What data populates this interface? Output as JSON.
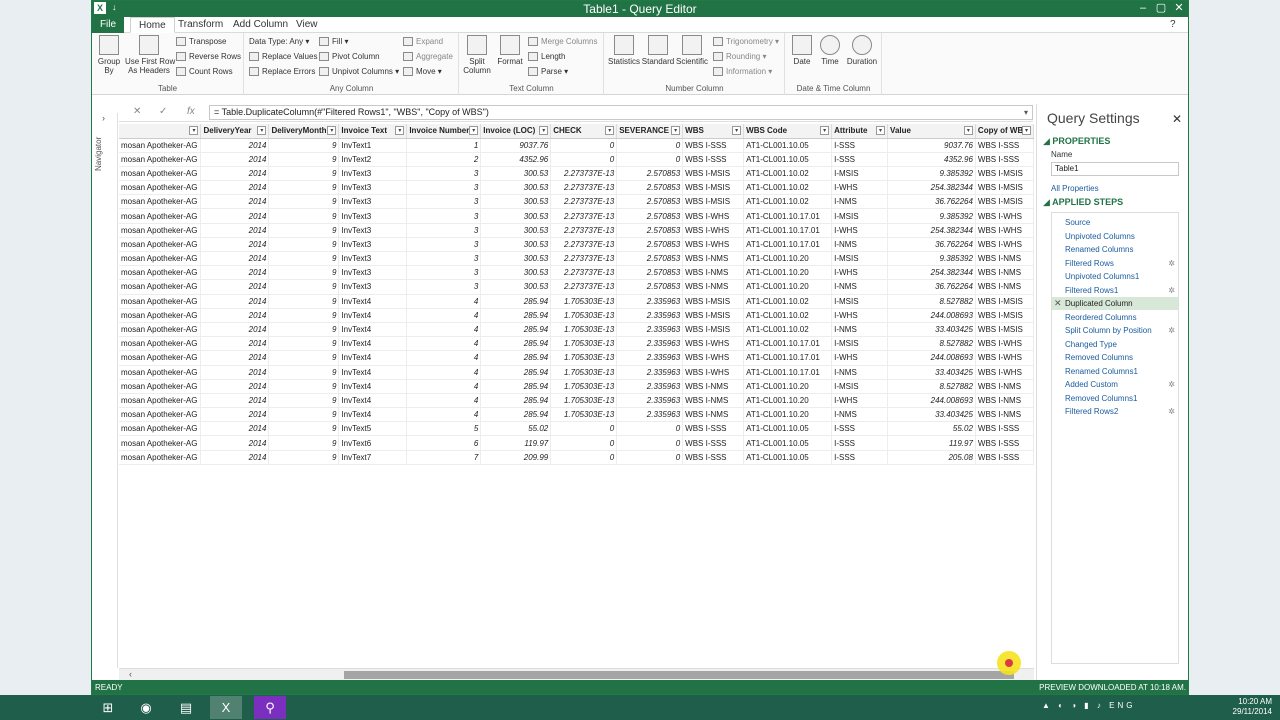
{
  "window": {
    "title": "Table1 - Query Editor"
  },
  "ribbon": {
    "tabs": [
      "File",
      "Home",
      "Transform",
      "Add Column",
      "View"
    ],
    "table": {
      "label": "Table",
      "group_by": "Group\nBy",
      "first_row": "Use First Row\nAs Headers",
      "transpose": "Transpose",
      "reverse_rows": "Reverse Rows",
      "count_rows": "Count Rows"
    },
    "any_column": {
      "label": "Any Column",
      "data_type": "Data Type: Any",
      "replace_values": "Replace Values",
      "replace_errors": "Replace Errors",
      "fill": "Fill",
      "pivot": "Pivot Column",
      "unpivot": "Unpivot Columns",
      "expand": "Expand",
      "aggregate": "Aggregate",
      "move": "Move"
    },
    "text_column": {
      "label": "Text Column",
      "split": "Split\nColumn",
      "format": "Format",
      "merge": "Merge Columns",
      "length": "Length",
      "parse": "Parse"
    },
    "number_column": {
      "label": "Number Column",
      "statistics": "Statistics",
      "standard": "Standard",
      "scientific": "Scientific",
      "trigonometry": "Trigonometry",
      "rounding": "Rounding",
      "information": "Information"
    },
    "datetime_column": {
      "label": "Date & Time Column",
      "date": "Date",
      "time": "Time",
      "duration": "Duration"
    }
  },
  "navigator": {
    "label": "Navigator"
  },
  "formula": {
    "text": "= Table.DuplicateColumn(#\"Filtered Rows1\", \"WBS\", \"Copy of WBS\")",
    "fx": "fx"
  },
  "grid": {
    "columns": [
      "",
      "DeliveryYear",
      "DeliveryMonth",
      "Invoice Text",
      "Invoice Number",
      "Invoice (LOC)",
      "CHECK",
      "SEVERANCE",
      "WBS",
      "WBS Code",
      "Attribute",
      "Value",
      "Copy of WBS"
    ],
    "rows": [
      [
        "mosan Apotheker-AG",
        "2014",
        "9",
        "InvText1",
        "1",
        "9037.76",
        "0",
        "0",
        "WBS I-SSS",
        "AT1-CL001.10.05",
        "I-SSS",
        "9037.76",
        "WBS I-SSS"
      ],
      [
        "mosan Apotheker-AG",
        "2014",
        "9",
        "InvText2",
        "2",
        "4352.96",
        "0",
        "0",
        "WBS I-SSS",
        "AT1-CL001.10.05",
        "I-SSS",
        "4352.96",
        "WBS I-SSS"
      ],
      [
        "mosan Apotheker-AG",
        "2014",
        "9",
        "InvText3",
        "3",
        "300.53",
        "2.273737E-13",
        "2.570853",
        "WBS I-MSIS",
        "AT1-CL001.10.02",
        "I-MSIS",
        "9.385392",
        "WBS I-MSIS"
      ],
      [
        "mosan Apotheker-AG",
        "2014",
        "9",
        "InvText3",
        "3",
        "300.53",
        "2.273737E-13",
        "2.570853",
        "WBS I-MSIS",
        "AT1-CL001.10.02",
        "I-WHS",
        "254.382344",
        "WBS I-MSIS"
      ],
      [
        "mosan Apotheker-AG",
        "2014",
        "9",
        "InvText3",
        "3",
        "300.53",
        "2.273737E-13",
        "2.570853",
        "WBS I-MSIS",
        "AT1-CL001.10.02",
        "I-NMS",
        "36.762264",
        "WBS I-MSIS"
      ],
      [
        "mosan Apotheker-AG",
        "2014",
        "9",
        "InvText3",
        "3",
        "300.53",
        "2.273737E-13",
        "2.570853",
        "WBS I-WHS",
        "AT1-CL001.10.17.01",
        "I-MSIS",
        "9.385392",
        "WBS I-WHS"
      ],
      [
        "mosan Apotheker-AG",
        "2014",
        "9",
        "InvText3",
        "3",
        "300.53",
        "2.273737E-13",
        "2.570853",
        "WBS I-WHS",
        "AT1-CL001.10.17.01",
        "I-WHS",
        "254.382344",
        "WBS I-WHS"
      ],
      [
        "mosan Apotheker-AG",
        "2014",
        "9",
        "InvText3",
        "3",
        "300.53",
        "2.273737E-13",
        "2.570853",
        "WBS I-WHS",
        "AT1-CL001.10.17.01",
        "I-NMS",
        "36.762264",
        "WBS I-WHS"
      ],
      [
        "mosan Apotheker-AG",
        "2014",
        "9",
        "InvText3",
        "3",
        "300.53",
        "2.273737E-13",
        "2.570853",
        "WBS I-NMS",
        "AT1-CL001.10.20",
        "I-MSIS",
        "9.385392",
        "WBS I-NMS"
      ],
      [
        "mosan Apotheker-AG",
        "2014",
        "9",
        "InvText3",
        "3",
        "300.53",
        "2.273737E-13",
        "2.570853",
        "WBS I-NMS",
        "AT1-CL001.10.20",
        "I-WHS",
        "254.382344",
        "WBS I-NMS"
      ],
      [
        "mosan Apotheker-AG",
        "2014",
        "9",
        "InvText3",
        "3",
        "300.53",
        "2.273737E-13",
        "2.570853",
        "WBS I-NMS",
        "AT1-CL001.10.20",
        "I-NMS",
        "36.762264",
        "WBS I-NMS"
      ],
      [
        "mosan Apotheker-AG",
        "2014",
        "9",
        "InvText4",
        "4",
        "285.94",
        "1.705303E-13",
        "2.335963",
        "WBS I-MSIS",
        "AT1-CL001.10.02",
        "I-MSIS",
        "8.527882",
        "WBS I-MSIS"
      ],
      [
        "mosan Apotheker-AG",
        "2014",
        "9",
        "InvText4",
        "4",
        "285.94",
        "1.705303E-13",
        "2.335963",
        "WBS I-MSIS",
        "AT1-CL001.10.02",
        "I-WHS",
        "244.008693",
        "WBS I-MSIS"
      ],
      [
        "mosan Apotheker-AG",
        "2014",
        "9",
        "InvText4",
        "4",
        "285.94",
        "1.705303E-13",
        "2.335963",
        "WBS I-MSIS",
        "AT1-CL001.10.02",
        "I-NMS",
        "33.403425",
        "WBS I-MSIS"
      ],
      [
        "mosan Apotheker-AG",
        "2014",
        "9",
        "InvText4",
        "4",
        "285.94",
        "1.705303E-13",
        "2.335963",
        "WBS I-WHS",
        "AT1-CL001.10.17.01",
        "I-MSIS",
        "8.527882",
        "WBS I-WHS"
      ],
      [
        "mosan Apotheker-AG",
        "2014",
        "9",
        "InvText4",
        "4",
        "285.94",
        "1.705303E-13",
        "2.335963",
        "WBS I-WHS",
        "AT1-CL001.10.17.01",
        "I-WHS",
        "244.008693",
        "WBS I-WHS"
      ],
      [
        "mosan Apotheker-AG",
        "2014",
        "9",
        "InvText4",
        "4",
        "285.94",
        "1.705303E-13",
        "2.335963",
        "WBS I-WHS",
        "AT1-CL001.10.17.01",
        "I-NMS",
        "33.403425",
        "WBS I-WHS"
      ],
      [
        "mosan Apotheker-AG",
        "2014",
        "9",
        "InvText4",
        "4",
        "285.94",
        "1.705303E-13",
        "2.335963",
        "WBS I-NMS",
        "AT1-CL001.10.20",
        "I-MSIS",
        "8.527882",
        "WBS I-NMS"
      ],
      [
        "mosan Apotheker-AG",
        "2014",
        "9",
        "InvText4",
        "4",
        "285.94",
        "1.705303E-13",
        "2.335963",
        "WBS I-NMS",
        "AT1-CL001.10.20",
        "I-WHS",
        "244.008693",
        "WBS I-NMS"
      ],
      [
        "mosan Apotheker-AG",
        "2014",
        "9",
        "InvText4",
        "4",
        "285.94",
        "1.705303E-13",
        "2.335963",
        "WBS I-NMS",
        "AT1-CL001.10.20",
        "I-NMS",
        "33.403425",
        "WBS I-NMS"
      ],
      [
        "mosan Apotheker-AG",
        "2014",
        "9",
        "InvText5",
        "5",
        "55.02",
        "0",
        "0",
        "WBS I-SSS",
        "AT1-CL001.10.05",
        "I-SSS",
        "55.02",
        "WBS I-SSS"
      ],
      [
        "mosan Apotheker-AG",
        "2014",
        "9",
        "InvText6",
        "6",
        "119.97",
        "0",
        "0",
        "WBS I-SSS",
        "AT1-CL001.10.05",
        "I-SSS",
        "119.97",
        "WBS I-SSS"
      ],
      [
        "mosan Apotheker-AG",
        "2014",
        "9",
        "InvText7",
        "7",
        "209.99",
        "0",
        "0",
        "WBS I-SSS",
        "AT1-CL001.10.05",
        "I-SSS",
        "205.08",
        "WBS I-SSS"
      ]
    ]
  },
  "query_settings": {
    "title": "Query Settings",
    "properties_heading": "PROPERTIES",
    "name_label": "Name",
    "name_value": "Table1",
    "all_properties": "All Properties",
    "applied_steps_heading": "APPLIED STEPS",
    "steps": [
      {
        "label": "Source",
        "gear": false
      },
      {
        "label": "Unpivoted Columns",
        "gear": false
      },
      {
        "label": "Renamed Columns",
        "gear": false
      },
      {
        "label": "Filtered Rows",
        "gear": true
      },
      {
        "label": "Unpivoted Columns1",
        "gear": false
      },
      {
        "label": "Filtered Rows1",
        "gear": true
      },
      {
        "label": "Duplicated Column",
        "gear": false,
        "selected": true
      },
      {
        "label": "Reordered Columns",
        "gear": false
      },
      {
        "label": "Split Column by Position",
        "gear": true
      },
      {
        "label": "Changed Type",
        "gear": false
      },
      {
        "label": "Removed Columns",
        "gear": false
      },
      {
        "label": "Renamed Columns1",
        "gear": false
      },
      {
        "label": "Added Custom",
        "gear": true
      },
      {
        "label": "Removed Columns1",
        "gear": false
      },
      {
        "label": "Filtered Rows2",
        "gear": true
      }
    ]
  },
  "status": {
    "left": "READY",
    "right": "PREVIEW DOWNLOADED AT 10:18 AM."
  },
  "taskbar": {
    "lang": "ENG",
    "time": "10:20 AM",
    "date": "29/11/2014"
  },
  "colors": {
    "accent": "#217346",
    "link": "#1a5b9e"
  }
}
